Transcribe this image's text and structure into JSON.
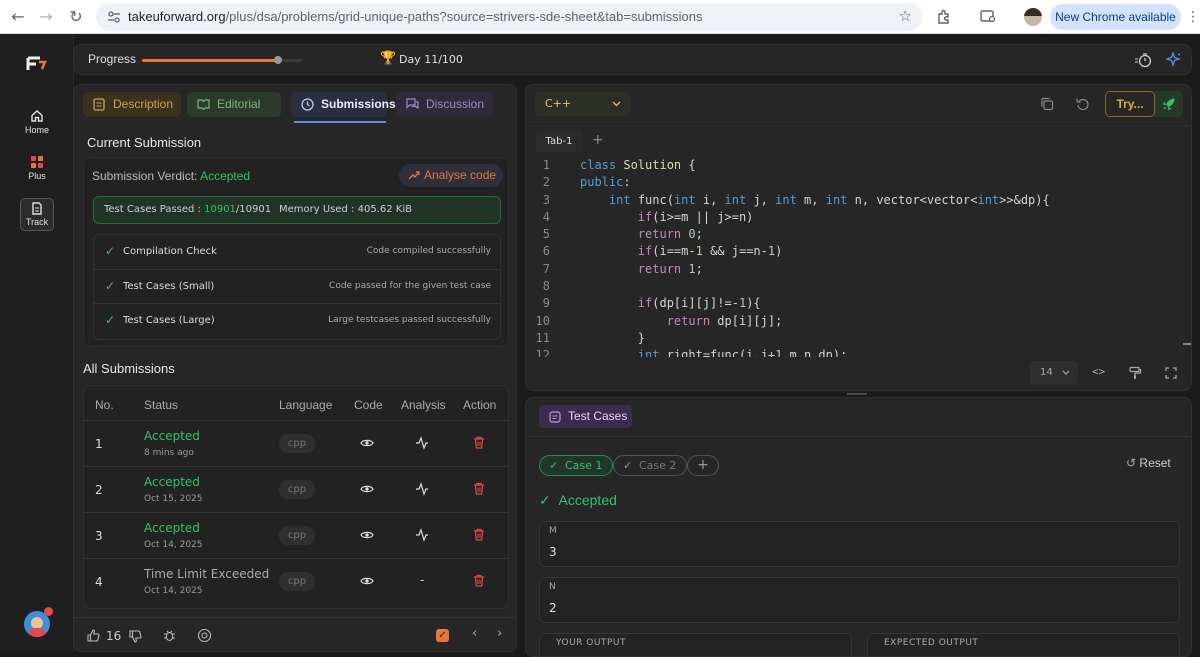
{
  "browser": {
    "url_host": "takeuforward.org",
    "url_path": "/plus/dsa/problems/grid-unique-paths?source=strivers-sde-sheet&tab=submissions",
    "new_chrome": "New Chrome available"
  },
  "sidebar": {
    "items": [
      {
        "label": "Home"
      },
      {
        "label": "Plus"
      },
      {
        "label": "Track"
      }
    ]
  },
  "progress": {
    "label": "Progress",
    "day": "Day 11/100",
    "fraction": 0.85
  },
  "tabs": [
    {
      "label": "Description"
    },
    {
      "label": "Editorial"
    },
    {
      "label": "Submissions"
    },
    {
      "label": "Discussion"
    }
  ],
  "current": {
    "heading": "Current Submission",
    "verdict_label": "Submission Verdict:",
    "verdict": "Accepted",
    "analyse": "Analyse code",
    "tc_label": "Test Cases Passed :",
    "tc_passed": "10901",
    "tc_total": "/10901",
    "memory": "Memory Used : 405.62 KiB",
    "checks": [
      {
        "name": "Compilation Check",
        "result": "Code compiled successfully"
      },
      {
        "name": "Test Cases (Small)",
        "result": "Code passed for the given test case"
      },
      {
        "name": "Test Cases (Large)",
        "result": "Large testcases passed successfully"
      }
    ]
  },
  "all": {
    "heading": "All Submissions",
    "columns": [
      "No.",
      "Status",
      "Language",
      "Code",
      "Analysis",
      "Action"
    ],
    "rows": [
      {
        "no": "1",
        "status": "Accepted",
        "date": "8 mins ago",
        "lang": "cpp",
        "analysis": ""
      },
      {
        "no": "2",
        "status": "Accepted",
        "date": "Oct 15, 2025",
        "lang": "cpp",
        "analysis": ""
      },
      {
        "no": "3",
        "status": "Accepted",
        "date": "Oct 14, 2025",
        "lang": "cpp",
        "analysis": ""
      },
      {
        "no": "4",
        "status": "Time Limit Exceeded",
        "date": "Oct 14, 2025",
        "lang": "cpp",
        "analysis": "-"
      }
    ]
  },
  "footer": {
    "likes": "16"
  },
  "editor": {
    "language": "C++",
    "try_label": "Try...",
    "tab": "Tab-1",
    "font_size": "14",
    "line_numbers": [
      "1",
      "2",
      "3",
      "4",
      "5",
      "6",
      "7",
      "8",
      "9",
      "10",
      "11",
      "12"
    ]
  },
  "testcases": {
    "title": "Test Cases",
    "cases": [
      "Case 1",
      "Case 2"
    ],
    "reset": "Reset",
    "result": "Accepted",
    "inputs": [
      {
        "name": "M",
        "value": "3"
      },
      {
        "name": "N",
        "value": "2"
      }
    ],
    "your_output": "YOUR OUTPUT",
    "expected_output": "EXPECTED OUTPUT"
  },
  "colors": {
    "accent": "#e8763a",
    "success": "#33c26b",
    "danger": "#e5484d",
    "selection": "#5b8def"
  }
}
